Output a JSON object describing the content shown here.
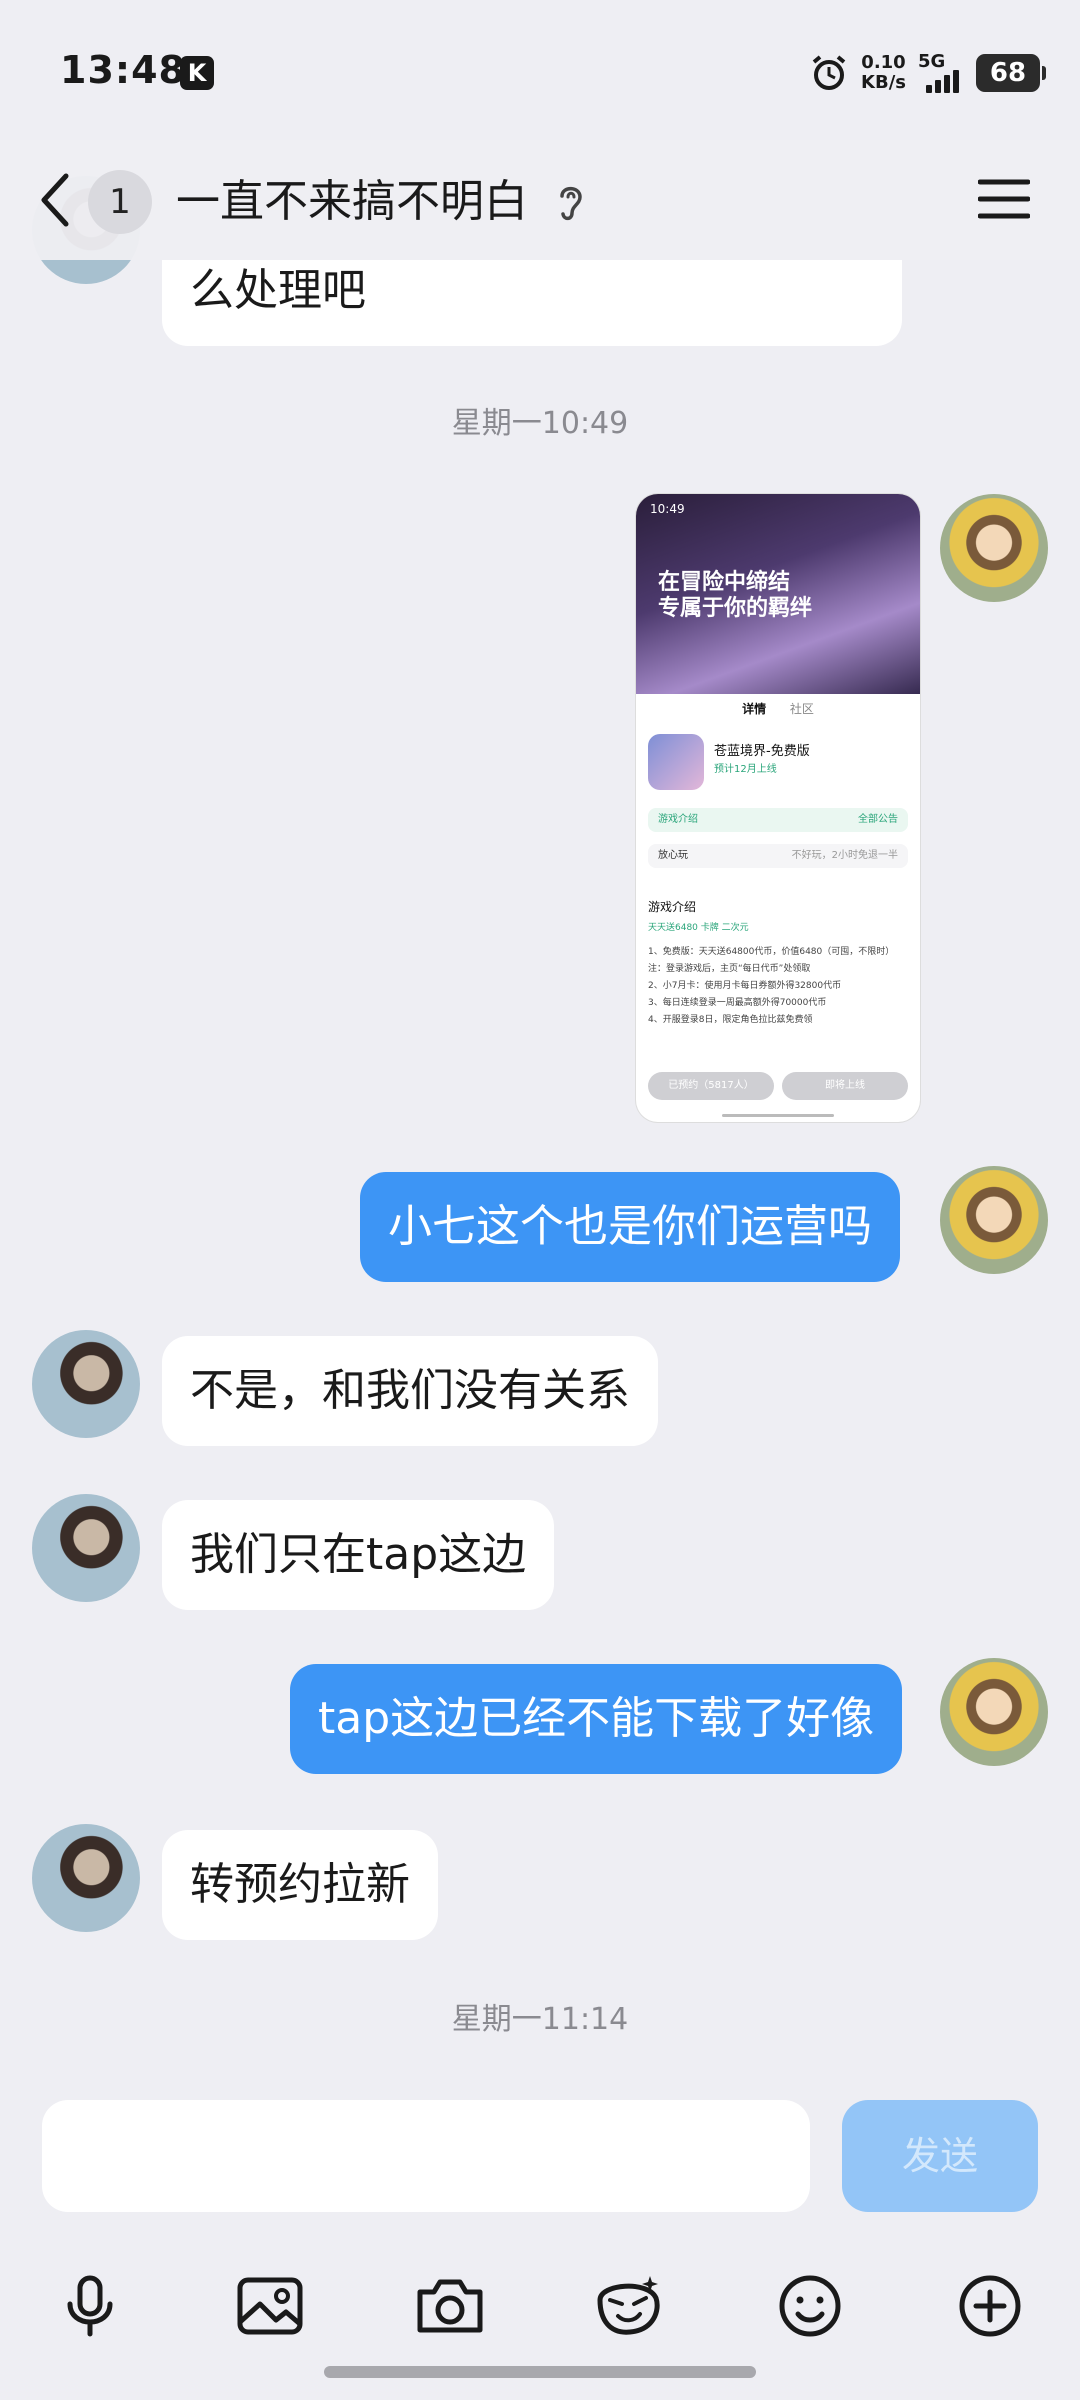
{
  "status_bar": {
    "time": "13:48",
    "k_badge": "K",
    "net_speed_value": "0.10",
    "net_speed_unit": "KB/s",
    "network": "5G",
    "battery": "68"
  },
  "header": {
    "unread_count": "1",
    "title": "一直不来搞不明白"
  },
  "messages": [
    {
      "side": "other",
      "text": "么处理吧"
    },
    {
      "timestamp": "星期一10:49"
    },
    {
      "side": "self",
      "type": "image"
    },
    {
      "side": "self",
      "text": "小七这个也是你们运营吗"
    },
    {
      "side": "other",
      "text": "不是，和我们没有关系"
    },
    {
      "side": "other",
      "text": "我们只在tap这边"
    },
    {
      "side": "self",
      "text": "tap这边已经不能下载了好像"
    },
    {
      "side": "other",
      "text": "转预约拉新"
    },
    {
      "timestamp": "星期一11:14"
    }
  ],
  "image_preview": {
    "status_time": "10:49",
    "banner_line1": "在冒险中缔结",
    "banner_line2": "专属于你的羁绊",
    "tab_detail": "详情",
    "tab_community": "社区",
    "game_title": "苍蓝境界-免费版",
    "game_sub": "预计12月上线",
    "row1_left": "游戏介绍",
    "row1_right": "全部公告",
    "row2_left": "放心玩",
    "row2_right": "不好玩，2小时免退一半",
    "section_title": "游戏介绍",
    "tags": "天天送6480  卡牌  二次元",
    "desc": "1、免费版：天天送64800代币，价值6480（可囤，不限时）\n注：登录游戏后，主页“每日代币”处领取\n2、小7月卡：使用月卡每日券额外得32800代币\n3、每日连续登录一周最高额外得70000代币\n4、开服登录8日，限定角色拉比兹免费领",
    "btn_left": "已预约（5817人）",
    "btn_right": "即将上线"
  },
  "input": {
    "placeholder": "",
    "send_label": "发送"
  },
  "colors": {
    "self_bubble": "#3d95f5",
    "other_bubble": "#ffffff",
    "send_button": "#93c5f7",
    "background": "#eeeef3"
  },
  "icons": {
    "back": "chevron-left-icon",
    "ear": "ear-icon",
    "menu": "menu-icon",
    "alarm": "alarm-icon",
    "voice": "microphone-icon",
    "image": "image-icon",
    "camera": "camera-icon",
    "sticker": "sticker-icon",
    "emoji": "emoji-icon",
    "plus": "plus-icon"
  }
}
